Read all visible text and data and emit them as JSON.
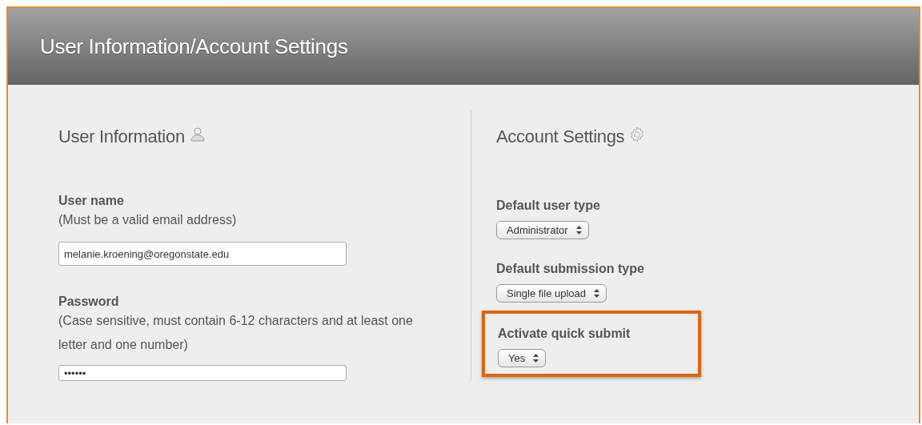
{
  "header": {
    "title": "User Information/Account Settings"
  },
  "user_information": {
    "title": "User Information",
    "fields": [
      {
        "label": "User name",
        "hint": "(Must be a valid email address)",
        "value": "melanie.kroening@oregonstate.edu",
        "kind": "text"
      },
      {
        "label": "Password",
        "hint": "(Case sensitive, must contain 6-12 characters and at least one letter and one number)",
        "value": "••••••",
        "kind": "password"
      }
    ]
  },
  "account_settings": {
    "title": "Account Settings",
    "fields": [
      {
        "label": "Default user type",
        "value": "Administrator",
        "highlighted": false
      },
      {
        "label": "Default submission type",
        "value": "Single file upload",
        "highlighted": false
      },
      {
        "label": "Activate quick submit",
        "value": "Yes",
        "highlighted": true
      }
    ]
  }
}
